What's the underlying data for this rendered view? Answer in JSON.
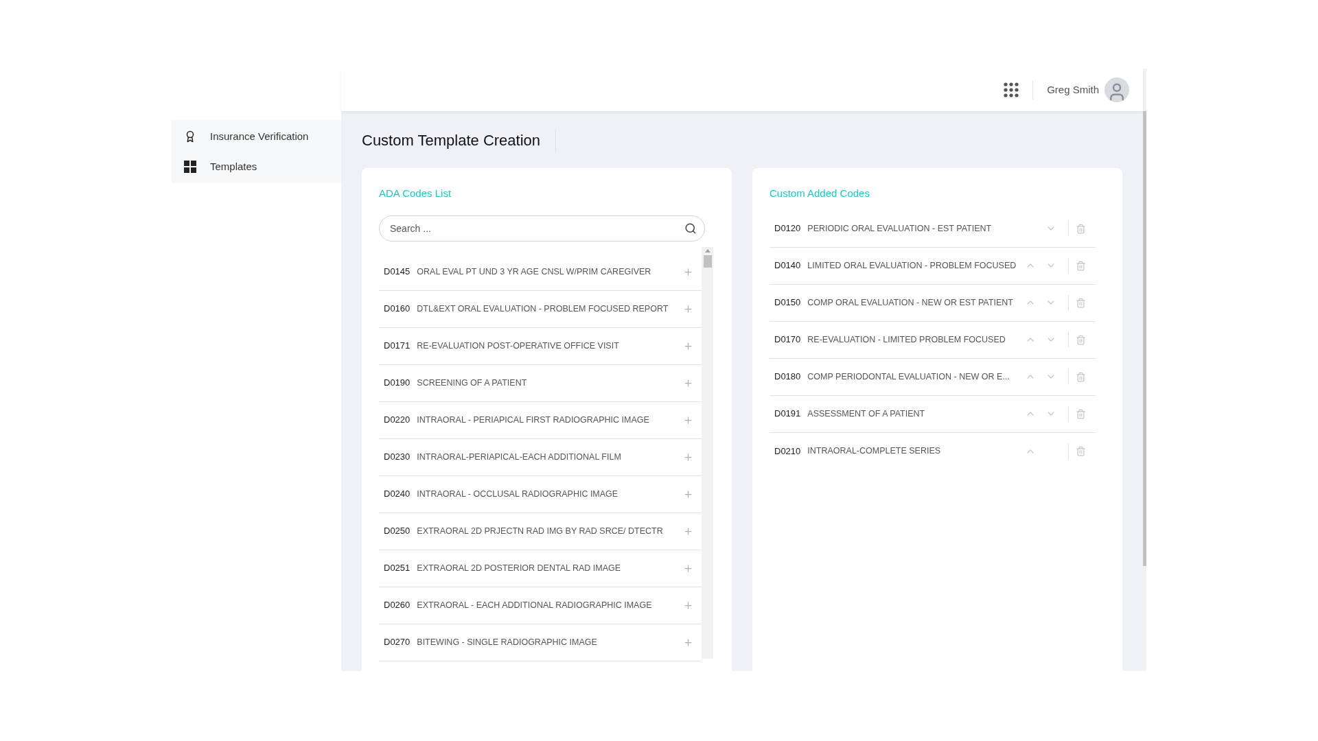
{
  "sidebar": {
    "items": [
      {
        "label": "Insurance Verification",
        "kind": "award"
      },
      {
        "label": "Templates",
        "kind": "grid"
      }
    ]
  },
  "header": {
    "user_name": "Greg Smith"
  },
  "page_title": "Custom Template Creation",
  "ada_codes": {
    "title": "ADA Codes List",
    "search": {
      "placeholder": "Search ..."
    },
    "rows": [
      {
        "code": "D0145",
        "description": "ORAL EVAL PT UND 3 YR AGE CNSL W/PRIM CAREGIVER"
      },
      {
        "code": "D0160",
        "description": "DTL&EXT ORAL EVALUATION - PROBLEM FOCUSED REPORT"
      },
      {
        "code": "D0171",
        "description": "RE-EVALUATION POST-OPERATIVE OFFICE VISIT"
      },
      {
        "code": "D0190",
        "description": "SCREENING OF A PATIENT"
      },
      {
        "code": "D0220",
        "description": "INTRAORAL - PERIAPICAL FIRST RADIOGRAPHIC IMAGE"
      },
      {
        "code": "D0230",
        "description": "INTRAORAL-PERIAPICAL-EACH ADDITIONAL FILM"
      },
      {
        "code": "D0240",
        "description": "INTRAORAL - OCCLUSAL RADIOGRAPHIC IMAGE"
      },
      {
        "code": "D0250",
        "description": "EXTRAORAL 2D PRJECTN RAD IMG BY RAD SRCE/ DTECTR"
      },
      {
        "code": "D0251",
        "description": "EXTRAORAL 2D POSTERIOR DENTAL RAD IMAGE"
      },
      {
        "code": "D0260",
        "description": "EXTRAORAL - EACH ADDITIONAL RADIOGRAPHIC IMAGE"
      },
      {
        "code": "D0270",
        "description": "BITEWING - SINGLE RADIOGRAPHIC IMAGE"
      }
    ]
  },
  "custom_codes": {
    "title": "Custom Added Codes",
    "rows": [
      {
        "code": "D0120",
        "description": "PERIODIC ORAL EVALUATION - EST PATIENT",
        "can_move_up": false,
        "can_move_down": true
      },
      {
        "code": "D0140",
        "description": "LIMITED ORAL EVALUATION - PROBLEM FOCUSED",
        "can_move_up": true,
        "can_move_down": true
      },
      {
        "code": "D0150",
        "description": "COMP ORAL EVALUATION - NEW OR EST PATIENT",
        "can_move_up": true,
        "can_move_down": true
      },
      {
        "code": "D0170",
        "description": "RE-EVALUATION - LIMITED PROBLEM FOCUSED",
        "can_move_up": true,
        "can_move_down": true
      },
      {
        "code": "D0180",
        "description": "COMP PERIODONTAL EVALUATION - NEW OR E...",
        "can_move_up": true,
        "can_move_down": true
      },
      {
        "code": "D0191",
        "description": "ASSESSMENT OF A PATIENT",
        "can_move_up": true,
        "can_move_down": true
      },
      {
        "code": "D0210",
        "description": "INTRAORAL-COMPLETE SERIES",
        "can_move_up": true,
        "can_move_down": false
      }
    ]
  }
}
